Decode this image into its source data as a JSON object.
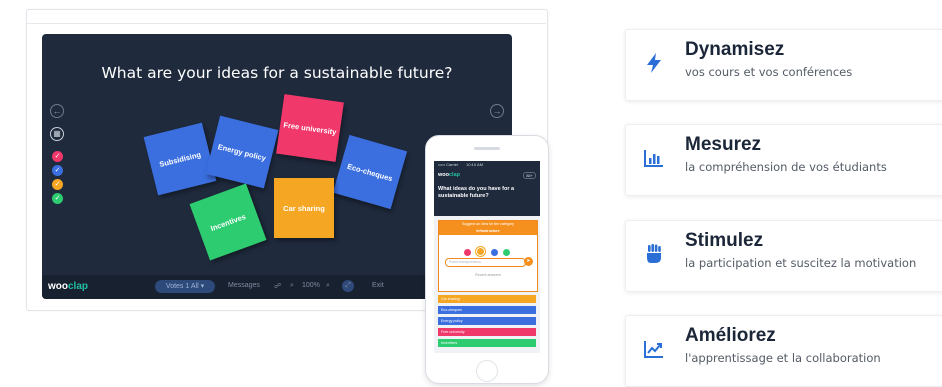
{
  "presentation": {
    "title": "What are your ideas for a sustainable future?",
    "notes": [
      {
        "label": "Subsidising",
        "color": "#3b6fe0"
      },
      {
        "label": "Energy policy",
        "color": "#3b6fe0"
      },
      {
        "label": "Free university",
        "color": "#f0386b"
      },
      {
        "label": "Eco-cheques",
        "color": "#3b6fe0"
      },
      {
        "label": "Car sharing",
        "color": "#f5a623"
      },
      {
        "label": "Incentives",
        "color": "#2ecc71"
      }
    ],
    "bottom_bar": {
      "logo_part1": "woo",
      "logo_part2": "clap",
      "votes_label": "Votes",
      "votes_count": "1",
      "votes_scope": "All",
      "messages_label": "Messages",
      "zoom": "100%",
      "exit_label": "Exit"
    },
    "status_dot_colors": [
      "#f0386b",
      "#3b6fe0",
      "#f5a623",
      "#2ecc71"
    ]
  },
  "phone": {
    "status_left": "••••• Carrier",
    "status_time": "10:10 AM",
    "logo_part1": "woo",
    "logo_part2": "clap",
    "badge": "88+",
    "question": "What ideas do you have for a sustainable future?",
    "card_header_line1": "Suggest an idea for the category",
    "card_header_line2": "Infrastructure",
    "input_placeholder": "Public transportation",
    "recent_label": "Recent answers",
    "answers": [
      {
        "label": "Car sharing",
        "color": "#f5a623"
      },
      {
        "label": "Eco-cheques",
        "color": "#3b6fe0"
      },
      {
        "label": "Energy policy",
        "color": "#3b6fe0"
      },
      {
        "label": "Free university",
        "color": "#f0386b"
      },
      {
        "label": "Incentives",
        "color": "#2ecc71"
      }
    ]
  },
  "features": [
    {
      "title": "Dynamisez",
      "subtitle": "vos cours et vos conférences",
      "icon": "lightning-icon"
    },
    {
      "title": "Mesurez",
      "subtitle": "la compréhension de vos étudiants",
      "icon": "bar-chart-icon"
    },
    {
      "title": "Stimulez",
      "subtitle": "la participation et suscitez la motivation",
      "icon": "raised-fist-icon"
    },
    {
      "title": "Améliorez",
      "subtitle": "l'apprentissage et la collaboration",
      "icon": "trend-chart-icon"
    }
  ],
  "colors": {
    "accent": "#2b6fd6",
    "dark": "#1b2638"
  }
}
